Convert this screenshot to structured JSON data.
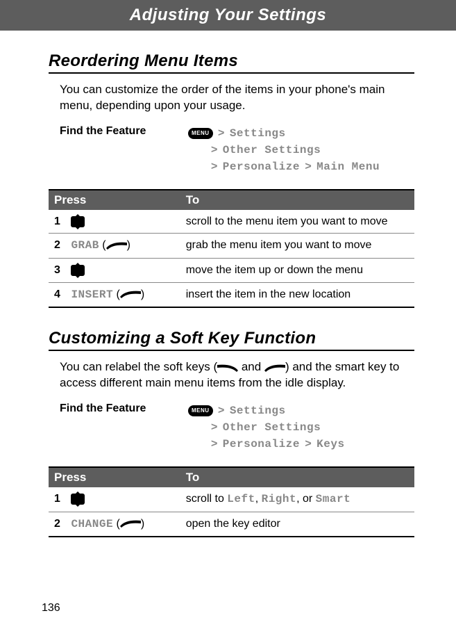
{
  "header": "Adjusting Your Settings",
  "page_number": "136",
  "section1": {
    "title": "Reordering Menu Items",
    "intro": "You can customize the order of the items in your phone's main menu, depending upon your usage.",
    "ftf_label": "Find the Feature",
    "menu_label": "MENU",
    "path": {
      "l1a": "Settings",
      "l2a": "Other Settings",
      "l3a": "Personalize",
      "l3b": "Main Menu"
    },
    "table": {
      "h1": "Press",
      "h2": "To",
      "r1": {
        "num": "1",
        "to": "scroll to the menu item you want to move"
      },
      "r2": {
        "num": "2",
        "press": "GRAB",
        "to": "grab the menu item you want to move"
      },
      "r3": {
        "num": "3",
        "to": "move the item up or down the menu"
      },
      "r4": {
        "num": "4",
        "press": "INSERT",
        "to": "insert the item in the new location"
      }
    }
  },
  "section2": {
    "title": "Customizing a Soft Key Function",
    "intro_a": "You can relabel the soft keys (",
    "intro_b": " and ",
    "intro_c": ") and the smart key to access different main menu items from the idle display.",
    "ftf_label": "Find the Feature",
    "menu_label": "MENU",
    "path": {
      "l1a": "Settings",
      "l2a": "Other Settings",
      "l3a": "Personalize",
      "l3b": "Keys"
    },
    "table": {
      "h1": "Press",
      "h2": "To",
      "r1": {
        "num": "1",
        "to_a": "scroll to ",
        "to_b": "Left",
        "to_c": ", ",
        "to_d": "Right",
        "to_e": ", or ",
        "to_f": "Smart"
      },
      "r2": {
        "num": "2",
        "press": "CHANGE",
        "to": "open the key editor"
      }
    }
  }
}
